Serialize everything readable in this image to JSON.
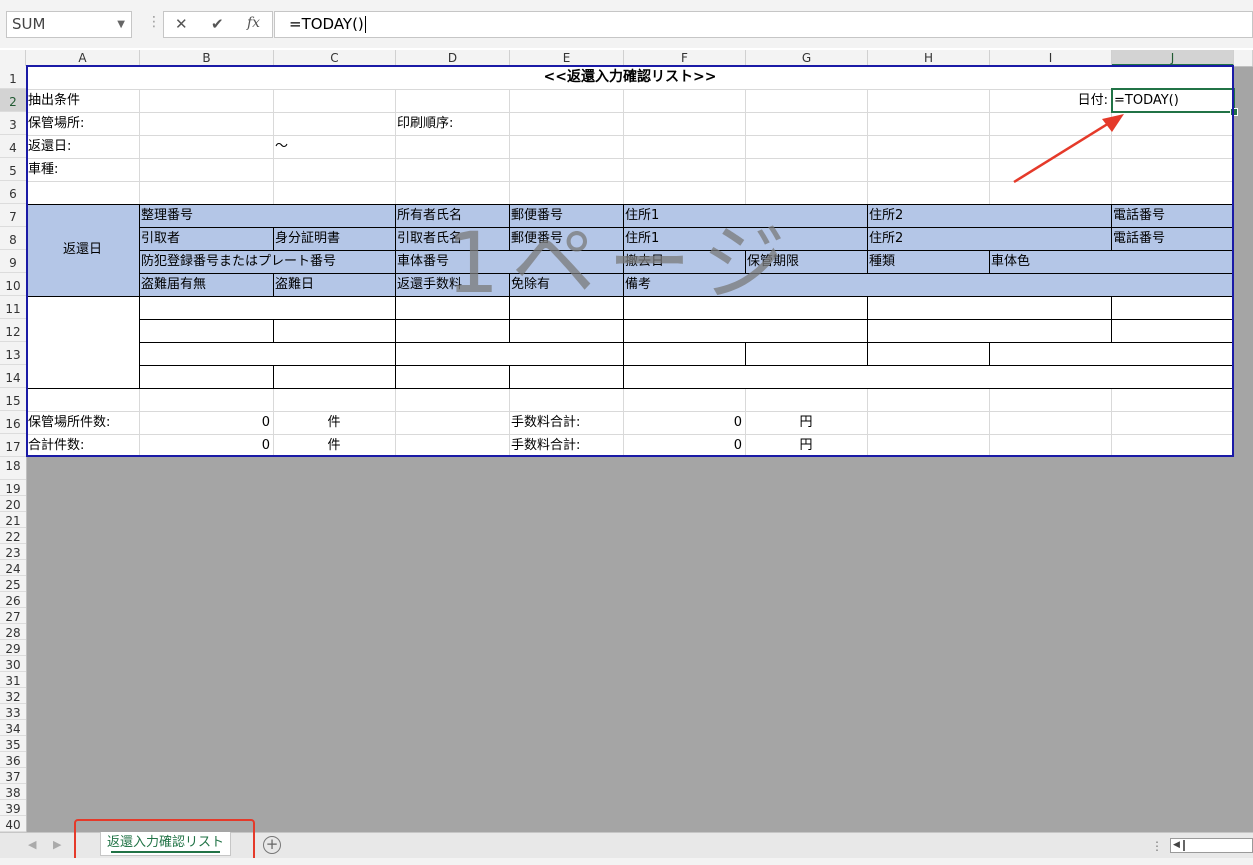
{
  "formula_bar": {
    "name_box": "SUM",
    "cancel_icon": "✕",
    "enter_icon": "✔",
    "fx_label": "fx",
    "formula": "=TODAY()"
  },
  "columns": [
    "A",
    "B",
    "C",
    "D",
    "E",
    "F",
    "G",
    "H",
    "I",
    "J"
  ],
  "selected_column": "J",
  "rows": [
    "1",
    "2",
    "3",
    "4",
    "5",
    "6",
    "7",
    "8",
    "9",
    "10",
    "11",
    "12",
    "13",
    "14",
    "15",
    "16",
    "17",
    "18",
    "19",
    "20",
    "21",
    "22",
    "23",
    "24",
    "25",
    "26",
    "27",
    "28",
    "29",
    "30",
    "31",
    "32",
    "33",
    "34",
    "35",
    "36",
    "37",
    "38",
    "39",
    "40"
  ],
  "selected_row": "2",
  "sheet": {
    "title": "<<返還入力確認リスト>>",
    "extract_condition": "抽出条件",
    "date_label": "日付:",
    "active_cell_value": "=TODAY()",
    "storage_label": "保管場所:",
    "print_order_label": "印刷順序:",
    "return_date_label": "返還日:",
    "tilde": "～",
    "car_type_label": "車種:",
    "header_return_date": "返還日",
    "hdr": {
      "seiri_bango": "整理番号",
      "shoyusha_shimei": "所有者氏名",
      "yubin_bango_1": "郵便番号",
      "jusho1_1": "住所1",
      "jusho2_1": "住所2",
      "denwa_1": "電話番号",
      "hikitorisha": "引取者",
      "mibun_shomeisho": "身分証明書",
      "hikitori_shimei": "引取者氏名",
      "yubin_bango_2": "郵便番号",
      "jusho1_2": "住所1",
      "jusho2_2": "住所2",
      "denwa_2": "電話番号",
      "bohan": "防犯登録番号またはプレート番号",
      "shatai_bango": "車体番号",
      "tekkyo_bi": "撤去日",
      "hokan_kigen": "保管期限",
      "shurui": "種類",
      "shatai_shoku": "車体色",
      "tonan_todoke": "盗難届有無",
      "tonan_bi": "盗難日",
      "henkan_tesuryo": "返還手数料",
      "menjo_u": "免除有",
      "biko": "備考"
    },
    "summary": {
      "storage_count_label": "保管場所件数:",
      "storage_count_value": "0",
      "count_unit_1": "件",
      "fee_total_label_1": "手数料合計:",
      "fee_total_value_1": "0",
      "yen_unit_1": "円",
      "total_count_label": "合計件数:",
      "total_count_value": "0",
      "count_unit_2": "件",
      "fee_total_label_2": "手数料合計:",
      "fee_total_value_2": "0",
      "yen_unit_2": "円"
    },
    "watermark": "1ページ"
  },
  "tabs": {
    "sheet_name": "返還入力確認リスト",
    "add_icon": "⊕"
  },
  "colors": {
    "header_fill": "#b4c6e7",
    "page_border": "#1a1aa6",
    "excel_green": "#217346",
    "annotation_red": "#e53a2a",
    "outside_area": "#a5a5a5"
  }
}
